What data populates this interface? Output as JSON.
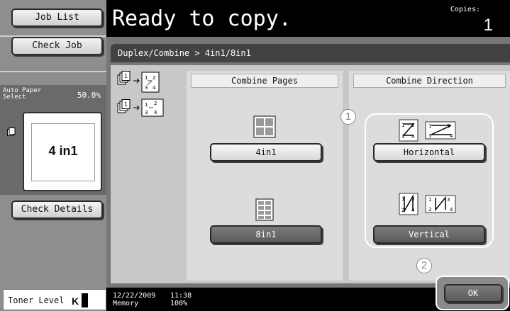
{
  "sidebar": {
    "job_list_label": "Job List",
    "check_job_label": "Check Job",
    "preview": {
      "paper_label": "Auto Paper Select",
      "zoom": "50.0%",
      "layout_label": "4 in1"
    },
    "check_details_label": "Check Details",
    "toner": {
      "label": "Toner Level",
      "color_letter": "K",
      "level": 0.15
    }
  },
  "header": {
    "status": "Ready to copy.",
    "copies_label": "Copies:",
    "copies_value": "1"
  },
  "breadcrumb": "Duplex/Combine > 4in1/8in1",
  "combine_pages": {
    "title": "Combine Pages",
    "options": [
      {
        "label": "4in1",
        "selected": true
      },
      {
        "label": "8in1",
        "selected": false
      }
    ]
  },
  "combine_direction": {
    "title": "Combine Direction",
    "options": [
      {
        "label": "Horizontal",
        "selected": true
      },
      {
        "label": "Vertical",
        "selected": false
      }
    ]
  },
  "callouts": [
    "1",
    "2"
  ],
  "sample_pages": {
    "four_up": [
      "1",
      "2",
      "3",
      "4"
    ],
    "four_up_alt": [
      "1",
      "2",
      "3",
      "4"
    ]
  },
  "footer": {
    "date": "12/22/2009",
    "memory_label": "Memory",
    "time": "11:38",
    "memory_value": "100%"
  },
  "ok_label": "OK",
  "colors": {
    "header_bg": "#000000",
    "panel_bg": "#dcdcdc",
    "button_selected": "#e8e8e8",
    "button_unselected": "#6a6a6a"
  }
}
